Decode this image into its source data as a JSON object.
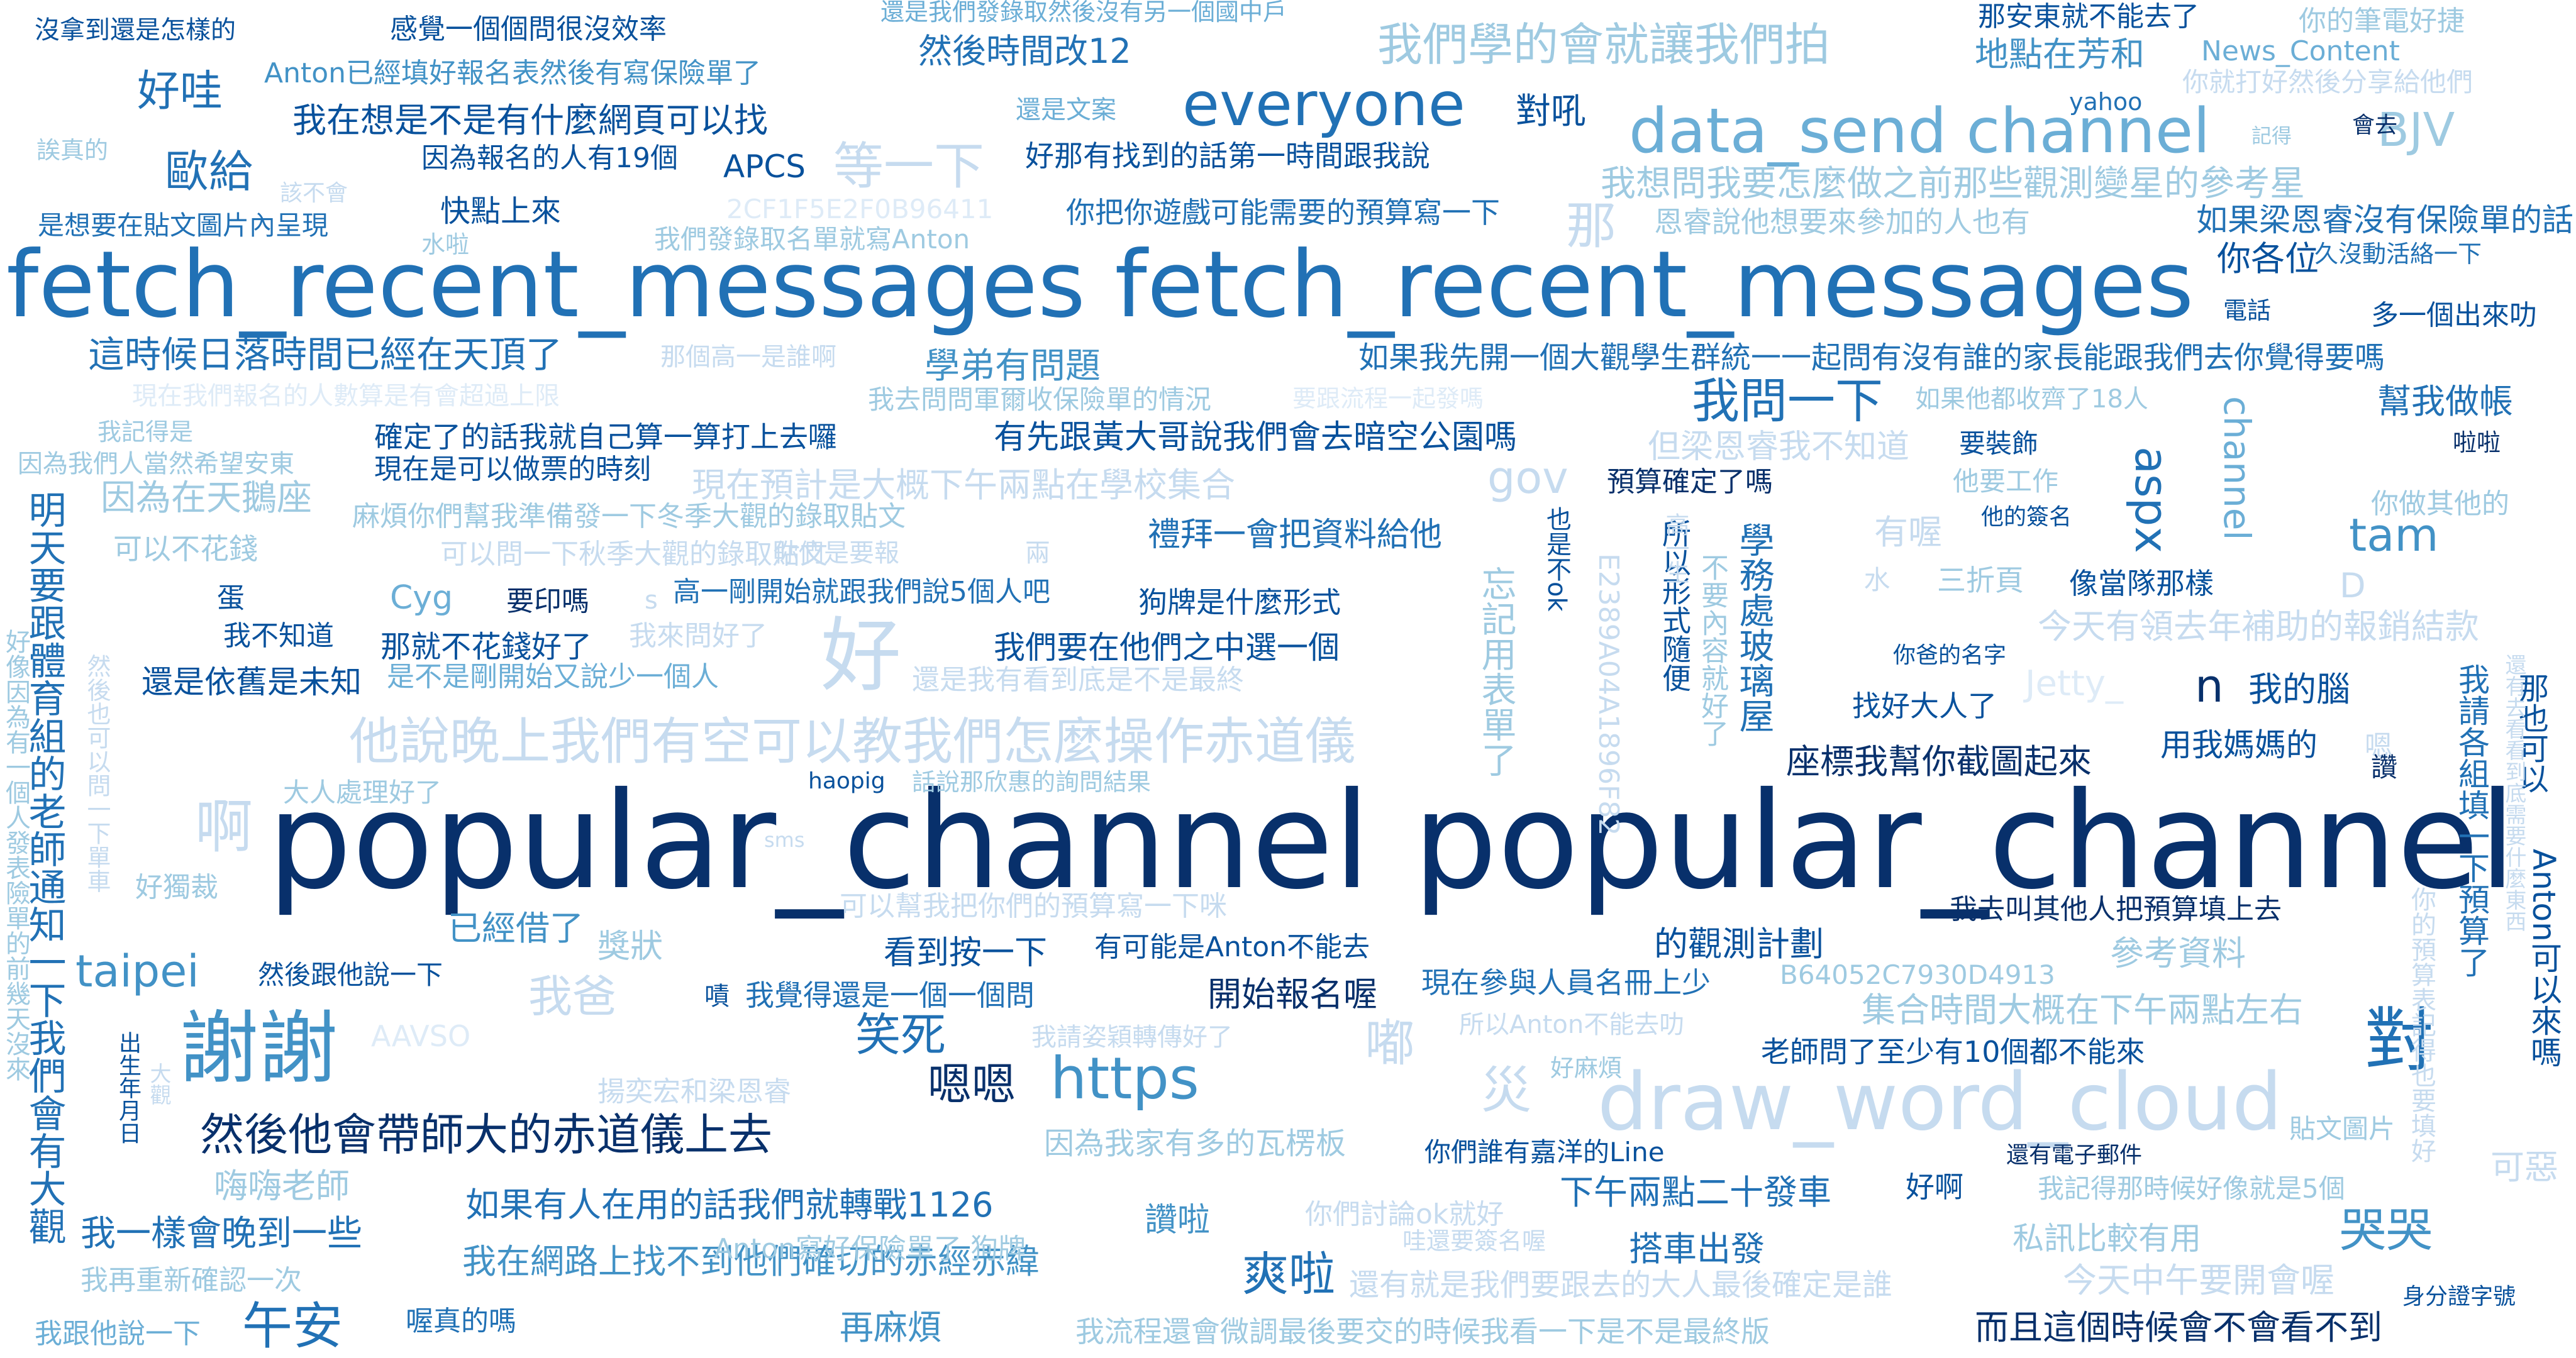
{
  "words": {
    "w1": "popular_channel popular_channel",
    "w2": "fetch_recent_messages fetch_recent_messages",
    "w3": "draw_word_cloud",
    "w4": "data_send channel",
    "w5": "everyone",
    "w6": "謝謝",
    "w7": "然後他會帶師大的赤道儀上去",
    "w8": "https",
    "w9": "我問一下",
    "w10": "好哇",
    "w11": "歐給",
    "w12": "對",
    "w13": "好",
    "w14": "他說晚上我們有空可以教我們怎麼操作赤道儀",
    "w15": "因為在天鵝座",
    "w16": "這時候日落時間已經在天頂了",
    "w17": "如果我先開一個大觀學生群統一一起問有沒有誰的家長能跟我們去你覺得要嗎",
    "w18": "有先跟黃大哥說我們會去暗空公園嗎",
    "w19": "確定了的話我就自己算一算打上去囉",
    "w20": "現在是可以做票的時刻",
    "w21": "taipei",
    "w22": "午安",
    "w23": "爽啦",
    "w24": "笑死",
    "w25": "嗯嗯",
    "w26": "開始報名喔",
    "w27": "座標我幫你截圖起來",
    "w28": "而且這個時候會不會看不到",
    "w29": "如果有人在用的話我們就轉戰1126",
    "w30": "我在網路上找不到他們確切的赤經赤緯",
    "w31": "沒拿到還是怎樣的",
    "w32": "感覺一個個問很沒效率",
    "w33": "然後時間改12",
    "w34": "我們學的會就讓我們拍",
    "w35": "那安東就不能去了",
    "w36": "地點在芳和",
    "w37": "News_Content",
    "w38": "你的筆電好捷",
    "w39": "Anton已經填好報名表然後有寫保險單了",
    "w40": "我在想是不是有什麼網頁可以找",
    "w41": "因為報名的人有19個",
    "w42": "APCS",
    "w43": "好那有找到的話第一時間跟我說",
    "w44": "等一下",
    "w45": "對吼",
    "w46": "BJV",
    "w47": "yahoo",
    "w48": "會去",
    "w49": "你就打好然後分享給他們",
    "w50": "我想問我要怎麼做之前那些觀測變星的參考星",
    "w51": "如果梁恩睿沒有保險單的話",
    "w52": "你各位",
    "w53": "快點上來",
    "w54": "你把你遊戲可能需要的預算寫一下",
    "w55": "2CF1F5E2F0B96411",
    "w56": "我們發錄取名單就寫Anton",
    "w57": "恩睿說他想要來參加的人也有",
    "w58": "那",
    "w59": "久沒動活絡一下",
    "w60": "電話",
    "w61": "多一個出來叻",
    "w62": "學弟有問題",
    "w63": "那個高一是誰啊",
    "w64": "幫我做帳",
    "w65": "我去問問軍爾收保險單的情況",
    "w66": "要跟流程一起發嗎",
    "w67": "如果他都收齊了18人",
    "w68": "channel",
    "w69": "aspx",
    "w70": "啦啦",
    "w71": "gov",
    "w72": "預算確定了嗎",
    "w73": "但梁恩睿我不知道",
    "w74": "他要工作",
    "w75": "你做其他的",
    "w76": "tam",
    "w77": "禮拜一會把資料給他",
    "w78": "麻煩你們幫我準備發一下冬季大觀的錄取貼文",
    "w79": "可以不花錢",
    "w80": "現在預計是大概下午兩點在學校集合",
    "w81": "有喔",
    "w82": "他的簽名",
    "w83": "三折頁",
    "w84": "像當隊那樣",
    "w85": "蛋",
    "w86": "Cyg",
    "w87": "要印嗎",
    "w88": "高一剛開始就跟我們說5個人吧",
    "w89": "狗牌是什麼形式",
    "w90": "今天有領去年補助的報銷結款",
    "w91": "我不知道",
    "w92": "那就不花錢好了",
    "w93": "我來問好了",
    "w94": "我們要在他們之中選一個",
    "w95": "你爸的名字",
    "w96": "還是依舊是未知",
    "w97": "是不是剛開始又說少一個人",
    "w98": "Jetty_",
    "w99": "n",
    "w100": "我的腦",
    "w101": "找好大人了",
    "w102": "用我媽媽的",
    "w103": "大人處理好了",
    "w104": "haopig",
    "w105": "話說那欣惠的詢問結果",
    "w106": "好獨裁",
    "w107": "可以幫我把你們的預算寫一下咪",
    "w108": "我去叫其他人把預算填上去",
    "w109": "已經借了",
    "w110": "獎狀",
    "w111": "看到按一下",
    "w112": "有可能是Anton不能去",
    "w113": "的觀測計劃",
    "w114": "參考資料",
    "w115": "然後跟他說一下",
    "w116": "我爸",
    "w117": "嘖",
    "w118": "我覺得還是一個一個問",
    "w119": "現在參與人員名冊上少",
    "w120": "B64052C7930D4913",
    "w121": "集合時間大概在下午兩點左右",
    "w122": "AAVSO",
    "w123": "我請姿穎轉傳好了",
    "w124": "所以Anton不能去叻",
    "w125": "老師問了至少有10個都不能來",
    "w126": "嘟",
    "w127": "好麻煩",
    "w128": "災",
    "w129": "揚奕宏和梁恩睿",
    "w130": "出生年月日",
    "w131": "因為我家有多的瓦楞板",
    "w132": "你們誰有嘉洋的Line",
    "w133": "還有電子郵件",
    "w134": "貼文圖片",
    "w135": "嗨嗨老師",
    "w136": "下午兩點二十發車",
    "w137": "好啊",
    "w138": "我記得那時候好像就是5個",
    "w139": "可惡",
    "w140": "我一樣會晚到一些",
    "w141": "讚啦",
    "w142": "你們討論ok就好",
    "w143": "哇還要簽名喔",
    "w144": "搭車出發",
    "w145": "私訊比較有用",
    "w146": "哭哭",
    "w147": "我再重新確認一次",
    "w148": "還有就是我們要跟去的大人最後確定是誰",
    "w149": "今天中午要開會喔",
    "w150": "身分證字號",
    "w151": "我跟他說一下",
    "w152": "喔真的嗎",
    "w153": "再麻煩",
    "w154": "我流程還會微調最後要交的時候我看一下是不是最終版",
    "w155": "Anton寫好保險單了 狗牌",
    "w156": "我記得是",
    "w157": "因為我們人當然希望安東",
    "w158": "誒真的",
    "w159": "是想要在貼文圖片內呈現",
    "w160": "水啦",
    "w161": "還是文案",
    "w162": "還是我們發錄取然後沒有另一個國中戶",
    "w163": "記得",
    "w164": "該不會",
    "w165": "明天要跟體育組的老師通知一下我們會有大觀",
    "w166": "好像因為有一個人發表險單的前幾天沒來",
    "w167": "然後也可以問一下單車",
    "w168": "大觀",
    "w169": "啊",
    "w170": "sms",
    "w171": "也是不ok",
    "w172": "所以形式隨便",
    "w173": "學務處玻璃屋",
    "w174": "不要內容就好了",
    "w175": "E2389A04A1896F82",
    "w176": "高一生",
    "w177": "忘記用表單了",
    "w178": "水",
    "w179": "讚",
    "w180": "那也可以",
    "w181": "Anton可以來嗎",
    "w182": "我請各組填一下預算了",
    "w183": "你的預算表記得也要填好",
    "w184": "D",
    "w185": "s",
    "w186": "嗯",
    "w187": "還有去看看到底需要什麼東西",
    "w188": "現在我們報名的人數算是有會超過上限",
    "w189": "可以問一下秋季大觀的錄取貼文",
    "w190": "你們是要報",
    "w191": "還是我有看到底是不是最終",
    "w192": "要裝飾",
    "w193": "兩"
  }
}
